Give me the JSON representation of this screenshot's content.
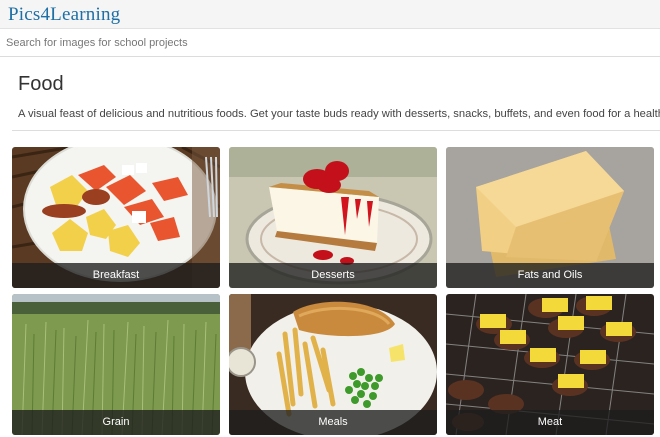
{
  "header": {
    "logo_text": "Pics4Learning"
  },
  "search": {
    "placeholder": "Search for images for school projects",
    "value": ""
  },
  "main": {
    "title": "Food",
    "description": "A visual feast of delicious and nutritious foods. Get your taste buds ready with desserts, snacks, buffets, and even food for a healthy diet.",
    "categories": [
      {
        "label": "Breakfast"
      },
      {
        "label": "Desserts"
      },
      {
        "label": "Fats and Oils"
      },
      {
        "label": "Grain"
      },
      {
        "label": "Meals"
      },
      {
        "label": "Meat"
      }
    ]
  },
  "colors": {
    "logo": "#1d6fa5",
    "caption_bg": "#1e1e1e",
    "header_bg": "#f5f5f5"
  }
}
